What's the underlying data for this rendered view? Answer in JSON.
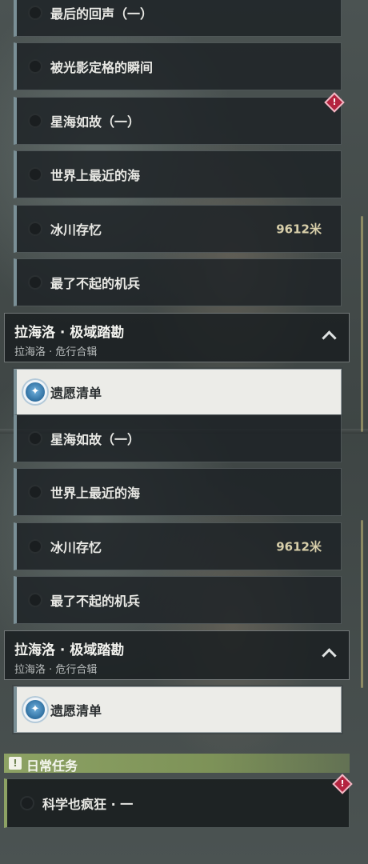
{
  "top_list": {
    "items": [
      {
        "label": "最后的回声（一）"
      },
      {
        "label": "被光影定格的瞬间"
      },
      {
        "label": "星海如故（一）"
      },
      {
        "label": "世界上最近的海"
      },
      {
        "label": "冰川存忆",
        "distance": "9612米"
      },
      {
        "label": "最了不起的机兵"
      }
    ],
    "group": {
      "title": "拉海洛 · 极域踏勘",
      "subtitle": "拉海洛 · 危行合辑"
    },
    "selected": {
      "label": "遗愿清单"
    }
  },
  "bottom_list": {
    "items": [
      {
        "label": "星海如故（一）"
      },
      {
        "label": "世界上最近的海"
      },
      {
        "label": "冰川存忆",
        "distance": "9612米"
      },
      {
        "label": "最了不起的机兵"
      }
    ],
    "group": {
      "title": "拉海洛 · 极域踏勘",
      "subtitle": "拉海洛 · 危行合辑"
    },
    "selected": {
      "label": "遗愿清单"
    }
  },
  "daily": {
    "header": "日常任务",
    "items": [
      {
        "label": "科学也疯狂 · 一"
      }
    ]
  },
  "icons": {
    "alert": "alert-diamond-icon",
    "nav": "navigation-compass-icon",
    "collapse": "chevron-up-icon",
    "daily": "exclamation-box-icon"
  },
  "colors": {
    "alert": "#b4243f",
    "daily_accent": "#8da264",
    "distance": "#d8cfaa"
  }
}
